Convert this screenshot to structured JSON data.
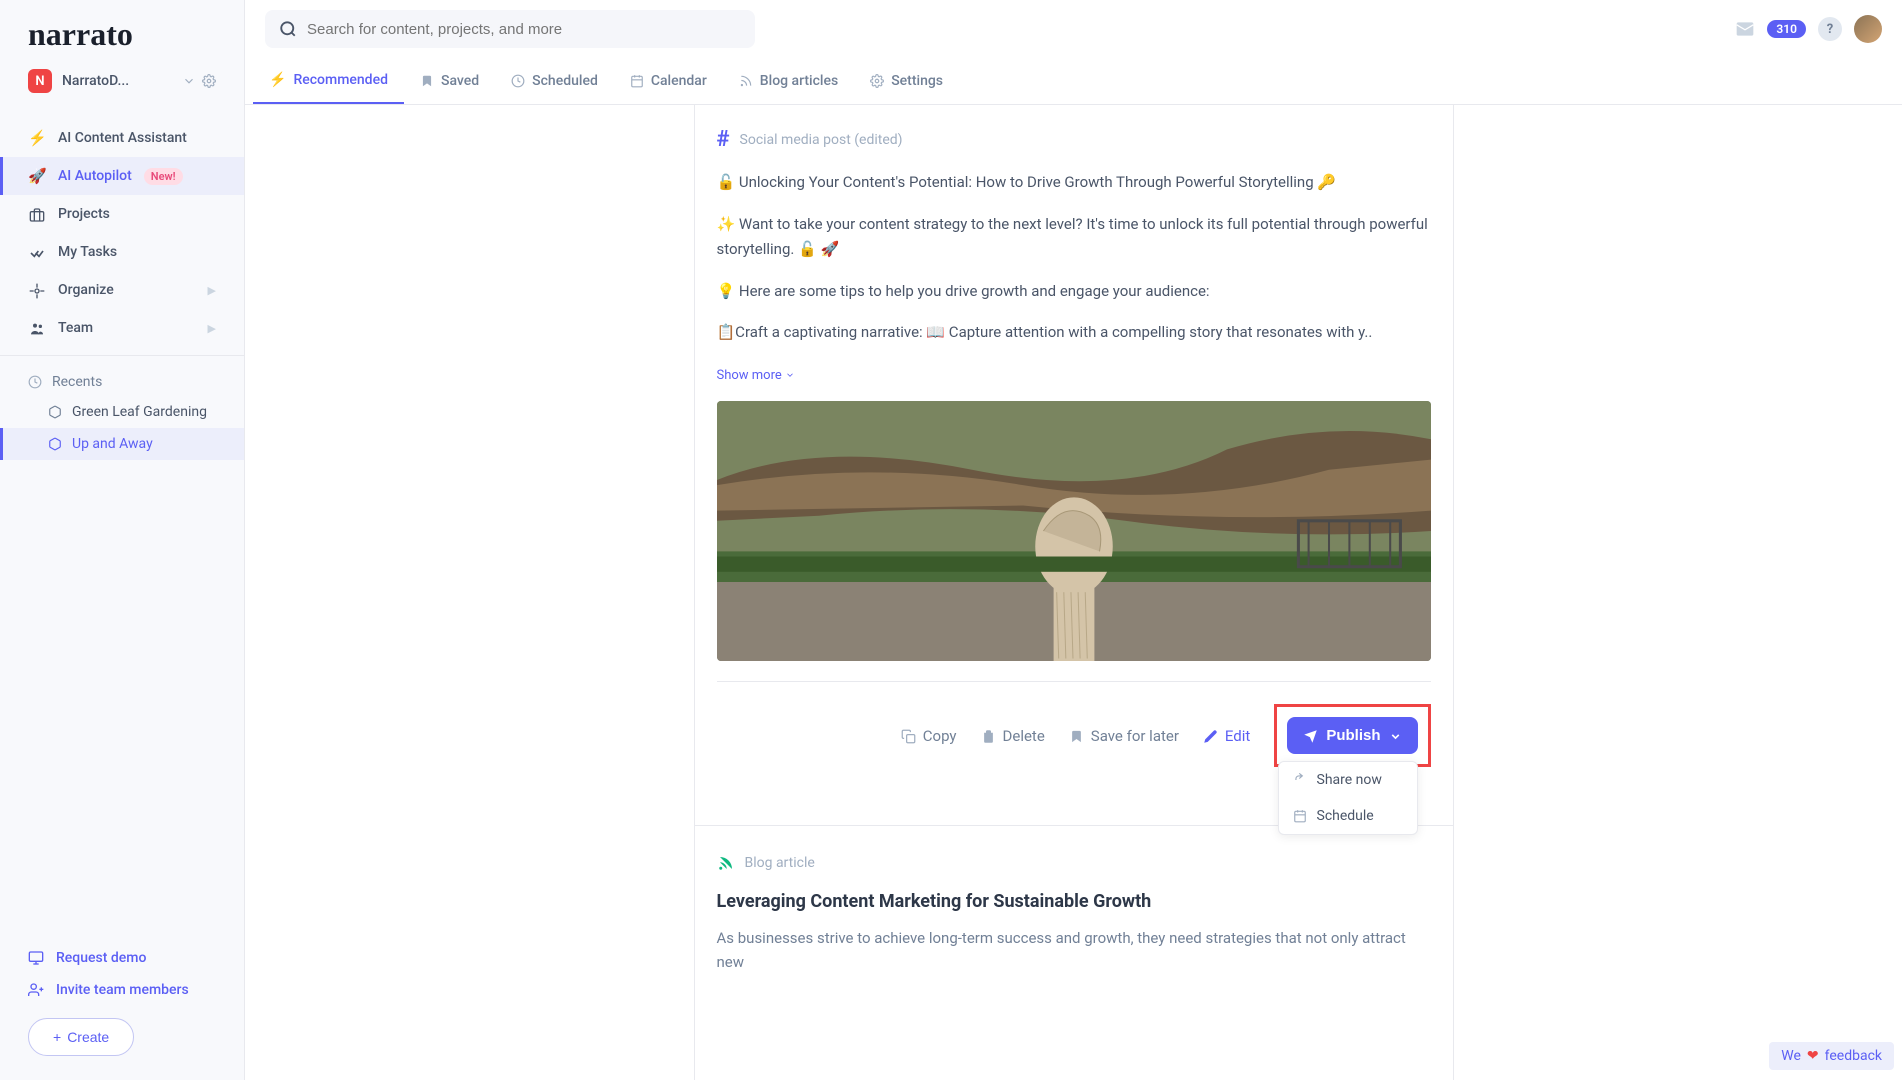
{
  "brand": "narrato",
  "workspace": {
    "initial": "N",
    "name": "NarratoD..."
  },
  "search": {
    "placeholder": "Search for content, projects, and more"
  },
  "sidebar": {
    "items": [
      {
        "label": "AI Content Assistant",
        "icon": "⚡"
      },
      {
        "label": "AI Autopilot",
        "icon": "🚀",
        "badge": "New!"
      },
      {
        "label": "Projects",
        "icon": "briefcase"
      },
      {
        "label": "My Tasks",
        "icon": "check"
      },
      {
        "label": "Organize",
        "icon": "gear",
        "expandable": true
      },
      {
        "label": "Team",
        "icon": "team",
        "expandable": true
      }
    ],
    "recents": {
      "header": "Recents",
      "items": [
        {
          "label": "Green Leaf Gardening"
        },
        {
          "label": "Up and Away"
        }
      ]
    },
    "bottom": {
      "request_demo": "Request demo",
      "invite": "Invite team members",
      "create": "Create"
    }
  },
  "topbar": {
    "notification_count": "310"
  },
  "tabs": [
    {
      "label": "Recommended",
      "icon": "⚡"
    },
    {
      "label": "Saved",
      "icon": "bookmark"
    },
    {
      "label": "Scheduled",
      "icon": "clock"
    },
    {
      "label": "Calendar",
      "icon": "calendar"
    },
    {
      "label": "Blog articles",
      "icon": "blog"
    },
    {
      "label": "Settings",
      "icon": "gear"
    }
  ],
  "post": {
    "type_label": "Social media post (edited)",
    "p1": "🔓 Unlocking Your Content's Potential: How to Drive Growth Through Powerful Storytelling 🔑",
    "p2": "✨ Want to take your content strategy to the next level? It's time to unlock its full potential through powerful storytelling. 🔓 🚀",
    "p3": "💡 Here are some tips to help you drive growth and engage your audience:",
    "p4": "📋Craft a captivating narrative: 📖 Capture attention with a compelling story that resonates with y..",
    "show_more": "Show more",
    "actions": {
      "copy": "Copy",
      "delete": "Delete",
      "save": "Save for later",
      "edit": "Edit",
      "publish": "Publish"
    },
    "publish_menu": {
      "share_now": "Share now",
      "schedule": "Schedule"
    }
  },
  "next_post": {
    "type_label": "Blog article",
    "title": "Leveraging Content Marketing for Sustainable Growth",
    "excerpt": "As businesses strive to achieve long-term success and growth, they need strategies that not only attract new"
  },
  "feedback": {
    "prefix": "We",
    "suffix": "feedback"
  }
}
